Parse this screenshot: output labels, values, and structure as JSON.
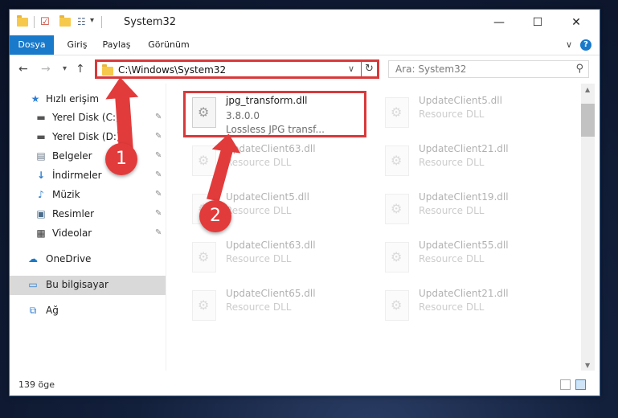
{
  "window": {
    "title": "System32",
    "controls": {
      "minimize": "—",
      "maximize": "☐",
      "close": "✕"
    }
  },
  "ribbon": {
    "tabs": [
      "Dosya",
      "Giriş",
      "Paylaş",
      "Görünüm"
    ],
    "help": "?"
  },
  "nav": {
    "back": "←",
    "forward": "→",
    "recent": "▾",
    "up": "↑",
    "address": "C:\\Windows\\System32",
    "address_dropdown": "∨",
    "refresh": "↻",
    "search_placeholder": "Ara: System32",
    "search_icon": "search-icon"
  },
  "sidebar": {
    "items": [
      {
        "label": "Hızlı erişim",
        "icon": "star-icon",
        "pinned": false
      },
      {
        "label": "Yerel Disk (C:)",
        "icon": "drive-icon",
        "pinned": true
      },
      {
        "label": "Yerel Disk (D:)",
        "icon": "drive-icon",
        "pinned": true
      },
      {
        "label": "Belgeler",
        "icon": "documents-icon",
        "pinned": true
      },
      {
        "label": "İndirmeler",
        "icon": "download-icon",
        "pinned": true
      },
      {
        "label": "Müzik",
        "icon": "music-icon",
        "pinned": true
      },
      {
        "label": "Resimler",
        "icon": "pictures-icon",
        "pinned": true
      },
      {
        "label": "Videolar",
        "icon": "videos-icon",
        "pinned": true
      },
      {
        "label": "OneDrive",
        "icon": "cloud-icon",
        "pinned": false
      },
      {
        "label": "Bu bilgisayar",
        "icon": "computer-icon",
        "pinned": false
      },
      {
        "label": "Ağ",
        "icon": "network-icon",
        "pinned": false
      }
    ],
    "pin_glyph": "📌"
  },
  "files": {
    "highlighted": {
      "name": "jpg_transform.dll",
      "version": "3.8.0.0",
      "description": "Lossless JPG transf..."
    },
    "tiles": [
      {
        "name": "UpdateClient5.dll",
        "sub": "Resource DLL"
      },
      {
        "name": "UpdateClient63.dll",
        "sub": "Resource DLL"
      },
      {
        "name": "UpdateClient21.dll",
        "sub": "Resource DLL"
      },
      {
        "name": "UpdateClient5.dll",
        "sub": "Resource DLL"
      },
      {
        "name": "UpdateClient19.dll",
        "sub": "Resource DLL"
      },
      {
        "name": "UpdateClient63.dll",
        "sub": "Resource DLL"
      },
      {
        "name": "UpdateClient55.dll",
        "sub": "Resource DLL"
      },
      {
        "name": "UpdateClient65.dll",
        "sub": "Resource DLL"
      },
      {
        "name": "UpdateClient21.dll",
        "sub": "Resource DLL"
      }
    ]
  },
  "status": {
    "item_count": "139 öge"
  },
  "annotations": {
    "step1": "1",
    "step2": "2"
  },
  "colors": {
    "accent": "#1979ca",
    "highlight_red": "#d9393a",
    "badge_red": "#e23b3b"
  }
}
